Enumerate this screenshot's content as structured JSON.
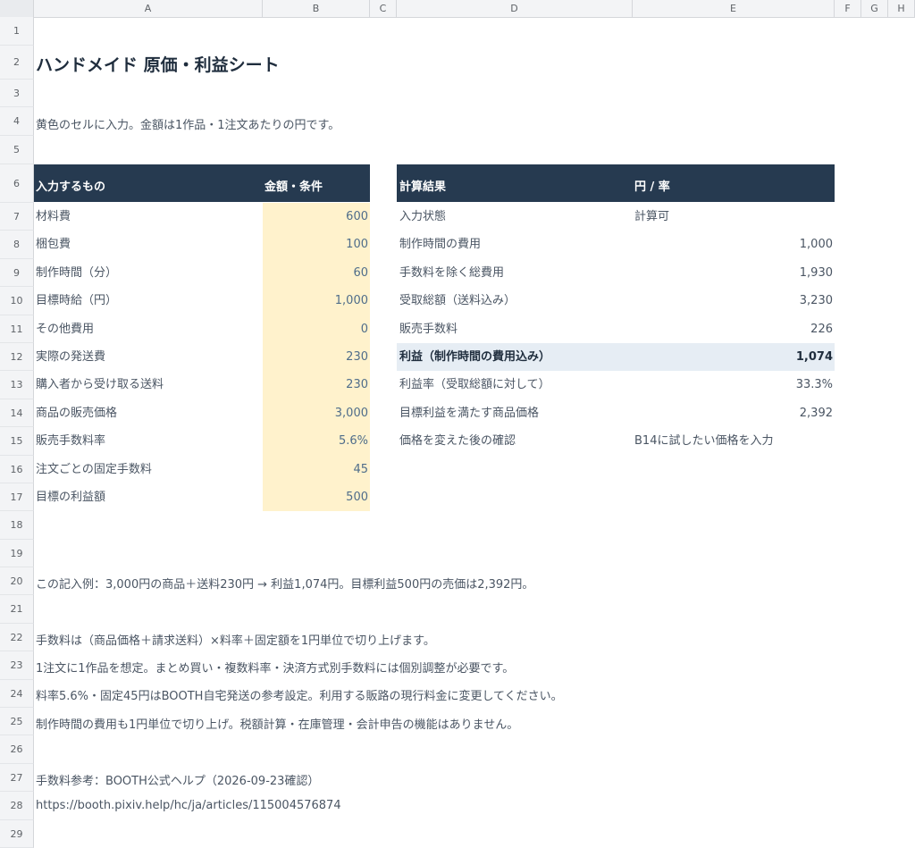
{
  "columns": [
    "A",
    "B",
    "C",
    "D",
    "E",
    "F",
    "G",
    "H"
  ],
  "rows": [
    "1",
    "2",
    "3",
    "4",
    "5",
    "6",
    "7",
    "8",
    "9",
    "10",
    "11",
    "12",
    "13",
    "14",
    "15",
    "16",
    "17",
    "18",
    "19",
    "20",
    "21",
    "22",
    "23",
    "24",
    "25",
    "26",
    "27",
    "28",
    "29"
  ],
  "title": "ハンドメイド 原価・利益シート",
  "instruction": "黄色のセルに入力。金額は1作品・1注文あたりの円です。",
  "input_table": {
    "header_item": "入力するもの",
    "header_value": "金額・条件",
    "items": [
      {
        "label": "材料費",
        "value": "600"
      },
      {
        "label": "梱包費",
        "value": "100"
      },
      {
        "label": "制作時間（分）",
        "value": "60"
      },
      {
        "label": "目標時給（円）",
        "value": "1,000"
      },
      {
        "label": "その他費用",
        "value": "0"
      },
      {
        "label": "実際の発送費",
        "value": "230"
      },
      {
        "label": "購入者から受け取る送料",
        "value": "230"
      },
      {
        "label": "商品の販売価格",
        "value": "3,000"
      },
      {
        "label": "販売手数料率",
        "value": "5.6%"
      },
      {
        "label": "注文ごとの固定手数料",
        "value": "45"
      },
      {
        "label": "目標の利益額",
        "value": "500"
      }
    ]
  },
  "result_table": {
    "header_item": "計算結果",
    "header_value": "円 / 率",
    "items": [
      {
        "label": "入力状態",
        "value": "計算可"
      },
      {
        "label": "制作時間の費用",
        "value": "1,000"
      },
      {
        "label": "手数料を除く総費用",
        "value": "1,930"
      },
      {
        "label": "受取総額（送料込み）",
        "value": "3,230"
      },
      {
        "label": "販売手数料",
        "value": "226"
      },
      {
        "label": "利益（制作時間の費用込み）",
        "value": "1,074"
      },
      {
        "label": "利益率（受取総額に対して）",
        "value": "33.3%"
      },
      {
        "label": "目標利益を満たす商品価格",
        "value": "2,392"
      },
      {
        "label": "価格を変えた後の確認",
        "value": "B14に試したい価格を入力"
      }
    ]
  },
  "notes": {
    "example": "この記入例：3,000円の商品＋送料230円 → 利益1,074円。目標利益500円の売価は2,392円。",
    "n1": "手数料は（商品価格＋請求送料）×料率＋固定額を1円単位で切り上げます。",
    "n2": "1注文に1作品を想定。まとめ買い・複数料率・決済方式別手数料には個別調整が必要です。",
    "n3": "料率5.6%・固定45円はBOOTH自宅発送の参考設定。利用する販路の現行料金に変更してください。",
    "n4": "制作時間の費用も1円単位で切り上げ。税額計算・在庫管理・会計申告の機能はありません。",
    "ref": "手数料参考：BOOTH公式ヘルプ（2026-09-23確認）",
    "url": "https://booth.pixiv.help/hc/ja/articles/115004576874"
  },
  "colors": {
    "header_band": "#263a50",
    "input_fill": "#fff2cc",
    "highlight_fill": "#e6edf4"
  }
}
